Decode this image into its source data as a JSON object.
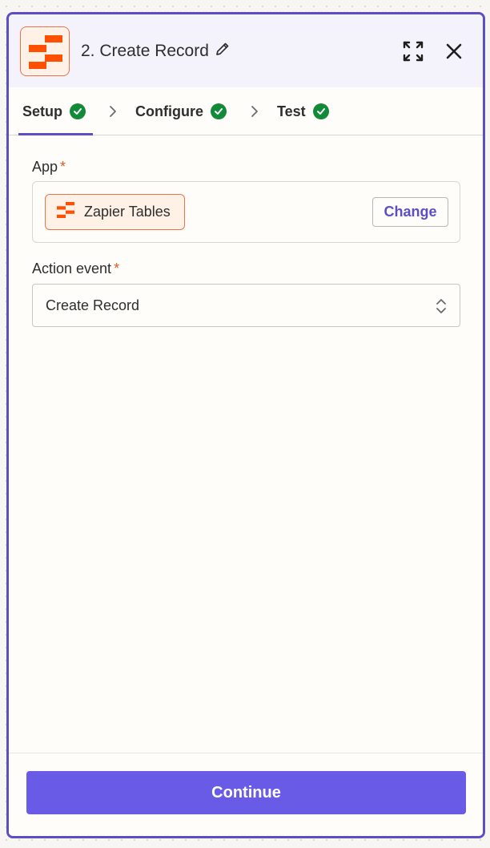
{
  "header": {
    "title": "2. Create Record",
    "app_icon": "zapier-tables-icon",
    "edit_icon": "pencil-icon",
    "expand_icon": "expand-icon",
    "close_icon": "close-icon"
  },
  "tabs": [
    {
      "label": "Setup",
      "status": "complete",
      "active": true
    },
    {
      "label": "Configure",
      "status": "complete",
      "active": false
    },
    {
      "label": "Test",
      "status": "complete",
      "active": false
    }
  ],
  "app_field": {
    "label": "App",
    "required_marker": "*",
    "selected_app": "Zapier Tables",
    "change_label": "Change"
  },
  "action_event": {
    "label": "Action event",
    "required_marker": "*",
    "value": "Create Record"
  },
  "footer": {
    "continue_label": "Continue"
  },
  "colors": {
    "accent": "#695be6",
    "panel_border": "#5c4fc4",
    "brand_orange": "#ff4f00",
    "success_green": "#138a3a",
    "required_orange": "#d95b25"
  }
}
